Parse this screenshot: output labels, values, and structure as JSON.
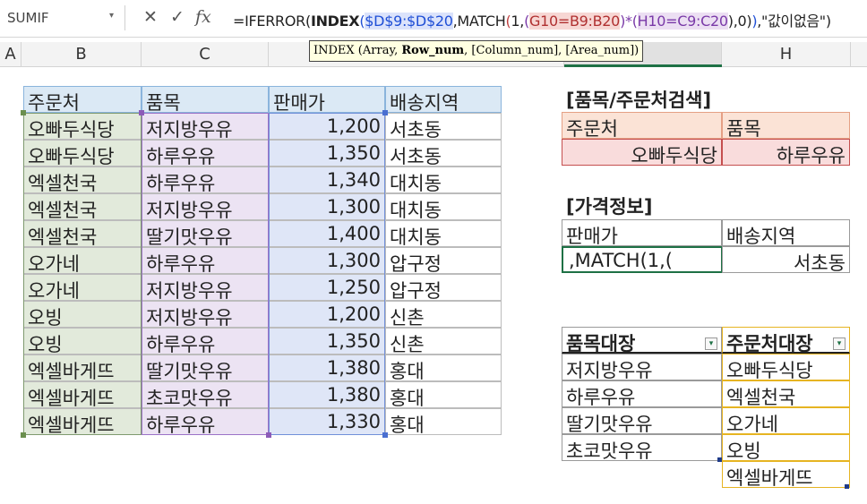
{
  "name_box": {
    "value": "SUMIF"
  },
  "formula_bar": {
    "cancel_glyph": "✕",
    "enter_glyph": "✓",
    "fx_label": "fx",
    "parts": {
      "a": "=IFERROR(",
      "b": "INDEX",
      "c": "(",
      "d": "$D$9:$D$20",
      "e": ",MATCH",
      "f": "(",
      "g": "1,",
      "h": "(",
      "i": "G10=B9:B20",
      "j": ")*(",
      "k": "H10=C9:C20",
      "l": "),0)",
      "m": ")",
      "n": ",\"값이없음\")"
    }
  },
  "tooltip": {
    "fn": "INDEX (Array, ",
    "current": "Row_num",
    "rest": ", [Column_num], [Area_num])"
  },
  "columns": {
    "a": "A",
    "b": "B",
    "c": "C",
    "h": "H"
  },
  "main_table": {
    "headers": [
      "주문처",
      "품목",
      "판매가",
      "배송지역"
    ],
    "rows": [
      [
        "오빠두식당",
        "저지방우유",
        "1,200",
        "서초동"
      ],
      [
        "오빠두식당",
        "하루우유",
        "1,350",
        "서초동"
      ],
      [
        "엑셀천국",
        "하루우유",
        "1,340",
        "대치동"
      ],
      [
        "엑셀천국",
        "저지방우유",
        "1,300",
        "대치동"
      ],
      [
        "엑셀천국",
        "딸기맛우유",
        "1,400",
        "대치동"
      ],
      [
        "오가네",
        "하루우유",
        "1,300",
        "압구정"
      ],
      [
        "오가네",
        "저지방우유",
        "1,250",
        "압구정"
      ],
      [
        "오빙",
        "저지방우유",
        "1,200",
        "신촌"
      ],
      [
        "오빙",
        "하루우유",
        "1,350",
        "신촌"
      ],
      [
        "엑셀바게뜨",
        "딸기맛우유",
        "1,380",
        "홍대"
      ],
      [
        "엑셀바게뜨",
        "초코맛우유",
        "1,380",
        "홍대"
      ],
      [
        "엑셀바게뜨",
        "하루우유",
        "1,330",
        "홍대"
      ]
    ]
  },
  "search": {
    "title": "[품목/주문처검색]",
    "customer_label": "주문처",
    "product_label": "품목",
    "customer_value": "오빠두식당",
    "product_value": "하루우유"
  },
  "price_info": {
    "title": "[가격정보]",
    "price_label": "판매가",
    "region_label": "배송지역",
    "price_editing": ",MATCH(1,(",
    "region_value": "서초동"
  },
  "lists": {
    "products_header": "품목대장",
    "customers_header": "주문처대장",
    "filter_glyph": "▾",
    "products": [
      "저지방우유",
      "하루우유",
      "딸기맛우유",
      "초코맛우유"
    ],
    "customers": [
      "오빠두식당",
      "엑셀천국",
      "오가네",
      "오빙",
      "엑셀바게뜨"
    ]
  }
}
